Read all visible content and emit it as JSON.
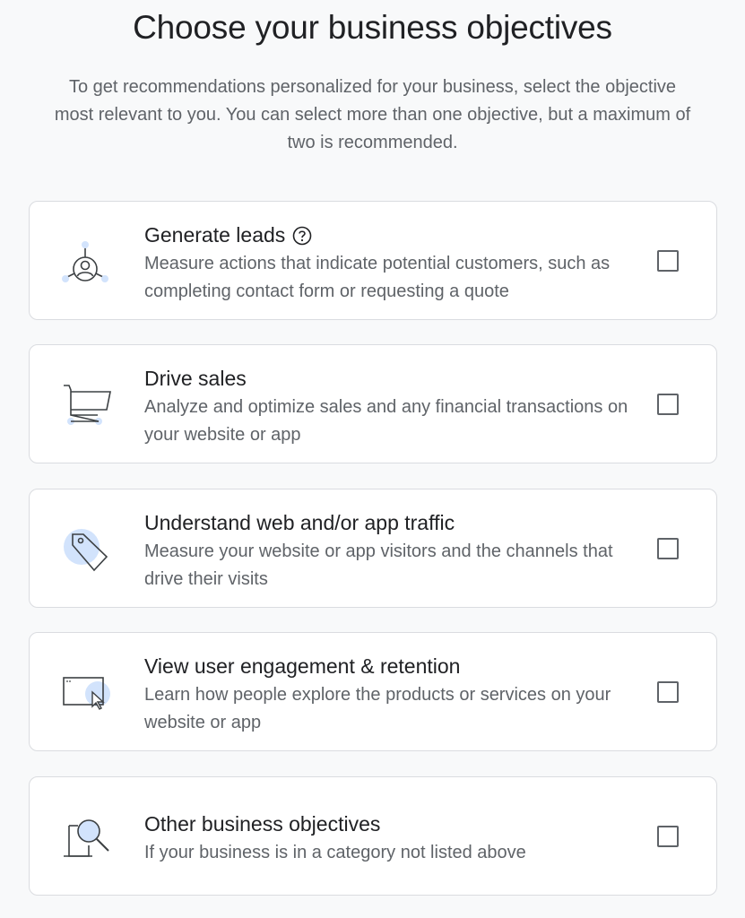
{
  "header": {
    "title": "Choose your business objectives",
    "subtitle": "To get recommendations personalized for your business, select the objective most relevant to you. You can select more than one objective, but a maximum of two is recommended."
  },
  "objectives": [
    {
      "icon": "leads-icon",
      "title": "Generate leads",
      "has_help": true,
      "description": "Measure actions that indicate potential customers, such as completing contact form or requesting a quote",
      "checked": false
    },
    {
      "icon": "shopping-cart-icon",
      "title": "Drive sales",
      "has_help": false,
      "description": "Analyze and optimize sales and any financial transactions on your website or app",
      "checked": false
    },
    {
      "icon": "tag-icon",
      "title": "Understand web and/or app traffic",
      "has_help": false,
      "description": "Measure your website or app visitors and the channels that drive their visits",
      "checked": false
    },
    {
      "icon": "browser-cursor-icon",
      "title": "View user engagement & retention",
      "has_help": false,
      "description": "Learn how people explore the products or services on your website or app",
      "checked": false
    },
    {
      "icon": "magnifier-document-icon",
      "title": "Other business objectives",
      "has_help": false,
      "description": "If your business is in a category not listed above",
      "checked": false
    }
  ],
  "colors": {
    "accent_light": "#d2e3fc",
    "accent": "#8ab4f8",
    "text_primary": "#202124",
    "text_secondary": "#5f6368",
    "border": "#dadce0"
  }
}
